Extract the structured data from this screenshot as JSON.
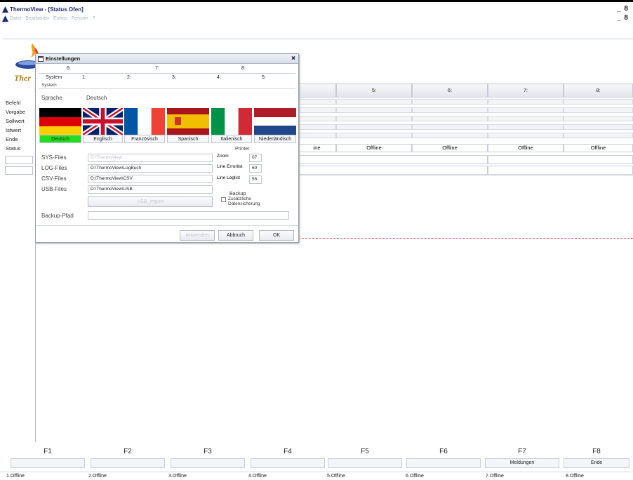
{
  "window": {
    "title": "ThermoView - [Status Ofen]",
    "menu": [
      "Datei",
      "Bearbeiten",
      "Extras",
      "Fenster",
      "?"
    ],
    "min_restore": "_ 8"
  },
  "logo_text": "Ther",
  "left_labels": [
    "Befehl",
    "Vorgabe",
    "Sollwert",
    "Istwert",
    "Ende",
    "Status"
  ],
  "columns": {
    "headers": [
      "5:",
      "6:",
      "7:",
      "8:"
    ],
    "status_partial": "ine",
    "status": [
      "Offline",
      "Offline",
      "Offline",
      "Offline"
    ]
  },
  "dialog": {
    "title": "Einstellungen",
    "close": "×",
    "tabs_top": [
      "6:",
      "7:",
      "8:"
    ],
    "tabs_bottom": [
      "System",
      "1:",
      "2:",
      "3:",
      "4:",
      "5:"
    ],
    "group_label": "System",
    "sprache_label": "Sprache",
    "sprache_value": "Deutsch",
    "languages": [
      "Deutsch",
      "Englisch",
      "Französisch",
      "Spanisch",
      "Italienisch",
      "Niederländisch"
    ],
    "active_language_color": "#22dd22",
    "files": [
      {
        "label": "SYS-Files",
        "value": "D:\\ThermoView",
        "disabled": true
      },
      {
        "label": "LOG-Files",
        "value": "D:\\ThermoView\\LogBuch",
        "disabled": false
      },
      {
        "label": "CSV-Files",
        "value": "D:\\ThermoView\\CSV",
        "disabled": false
      },
      {
        "label": "USB-Files",
        "value": "D:\\ThermoView\\USB",
        "disabled": false
      }
    ],
    "usb_import": "USB_Import",
    "printer": {
      "title": "Printer",
      "zoom_label": "Zoom",
      "zoom_value": "07",
      "line_error_label": "Line Errorlist",
      "line_error_value": "60",
      "line_log_label": "Line Loglist",
      "line_log_value": "55"
    },
    "backup": {
      "title": "Backup",
      "checkbox_label": "Zusätzliche Datensicherung"
    },
    "backup_pfad_label": "Backup-Pfad",
    "backup_pfad_value": "",
    "buttons": {
      "apply": "Anwenden",
      "cancel": "Abbruch",
      "ok": "OK"
    }
  },
  "fkeys": [
    {
      "label": "F1",
      "button": ""
    },
    {
      "label": "F2",
      "button": ""
    },
    {
      "label": "F3",
      "button": ""
    },
    {
      "label": "F4",
      "button": ""
    },
    {
      "label": "F5",
      "button": ""
    },
    {
      "label": "F6",
      "button": ""
    },
    {
      "label": "F7",
      "button": "Meldungen"
    },
    {
      "label": "F8",
      "button": "Ende"
    }
  ],
  "status_bar": [
    "1.Offline",
    "2.Offline",
    "3.Offline",
    "4.Offline",
    "5.Offline",
    "6.Offline",
    "7.Offline",
    "8.Offline"
  ]
}
